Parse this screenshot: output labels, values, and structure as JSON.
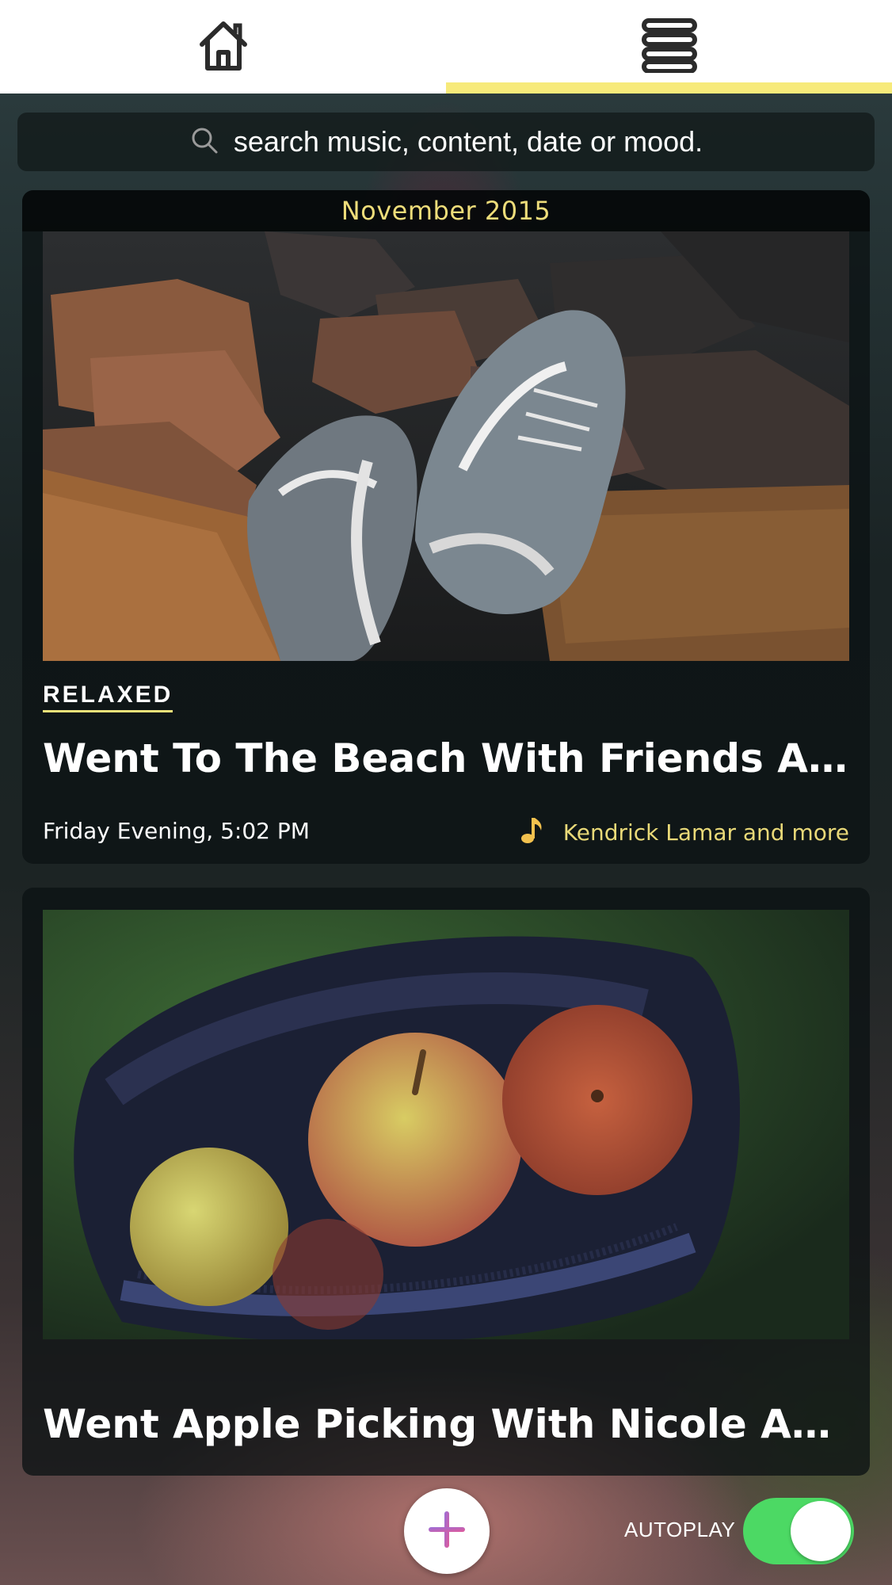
{
  "nav": {
    "home_icon": "home-icon",
    "list_icon": "list-icon",
    "active_tab": "list",
    "accent_color": "#f7ea7a"
  },
  "search": {
    "placeholder": "search music, content, date or mood.",
    "icon": "search-icon"
  },
  "entries": [
    {
      "month": "November 2015",
      "mood": "RELAXED",
      "title": "Went To The Beach With Friends And...",
      "time": "Friday Evening, 5:02 PM",
      "music": "Kendrick Lamar and more",
      "music_icon": "music-note-icon",
      "photo": "sneakers-on-rocks"
    },
    {
      "title": "Went Apple Picking With Nicole And B...",
      "photo": "apples-in-bag"
    }
  ],
  "controls": {
    "add_icon": "plus-icon",
    "autoplay_label": "AUTOPLAY",
    "autoplay_on": true,
    "toggle_color": "#4cd964"
  }
}
